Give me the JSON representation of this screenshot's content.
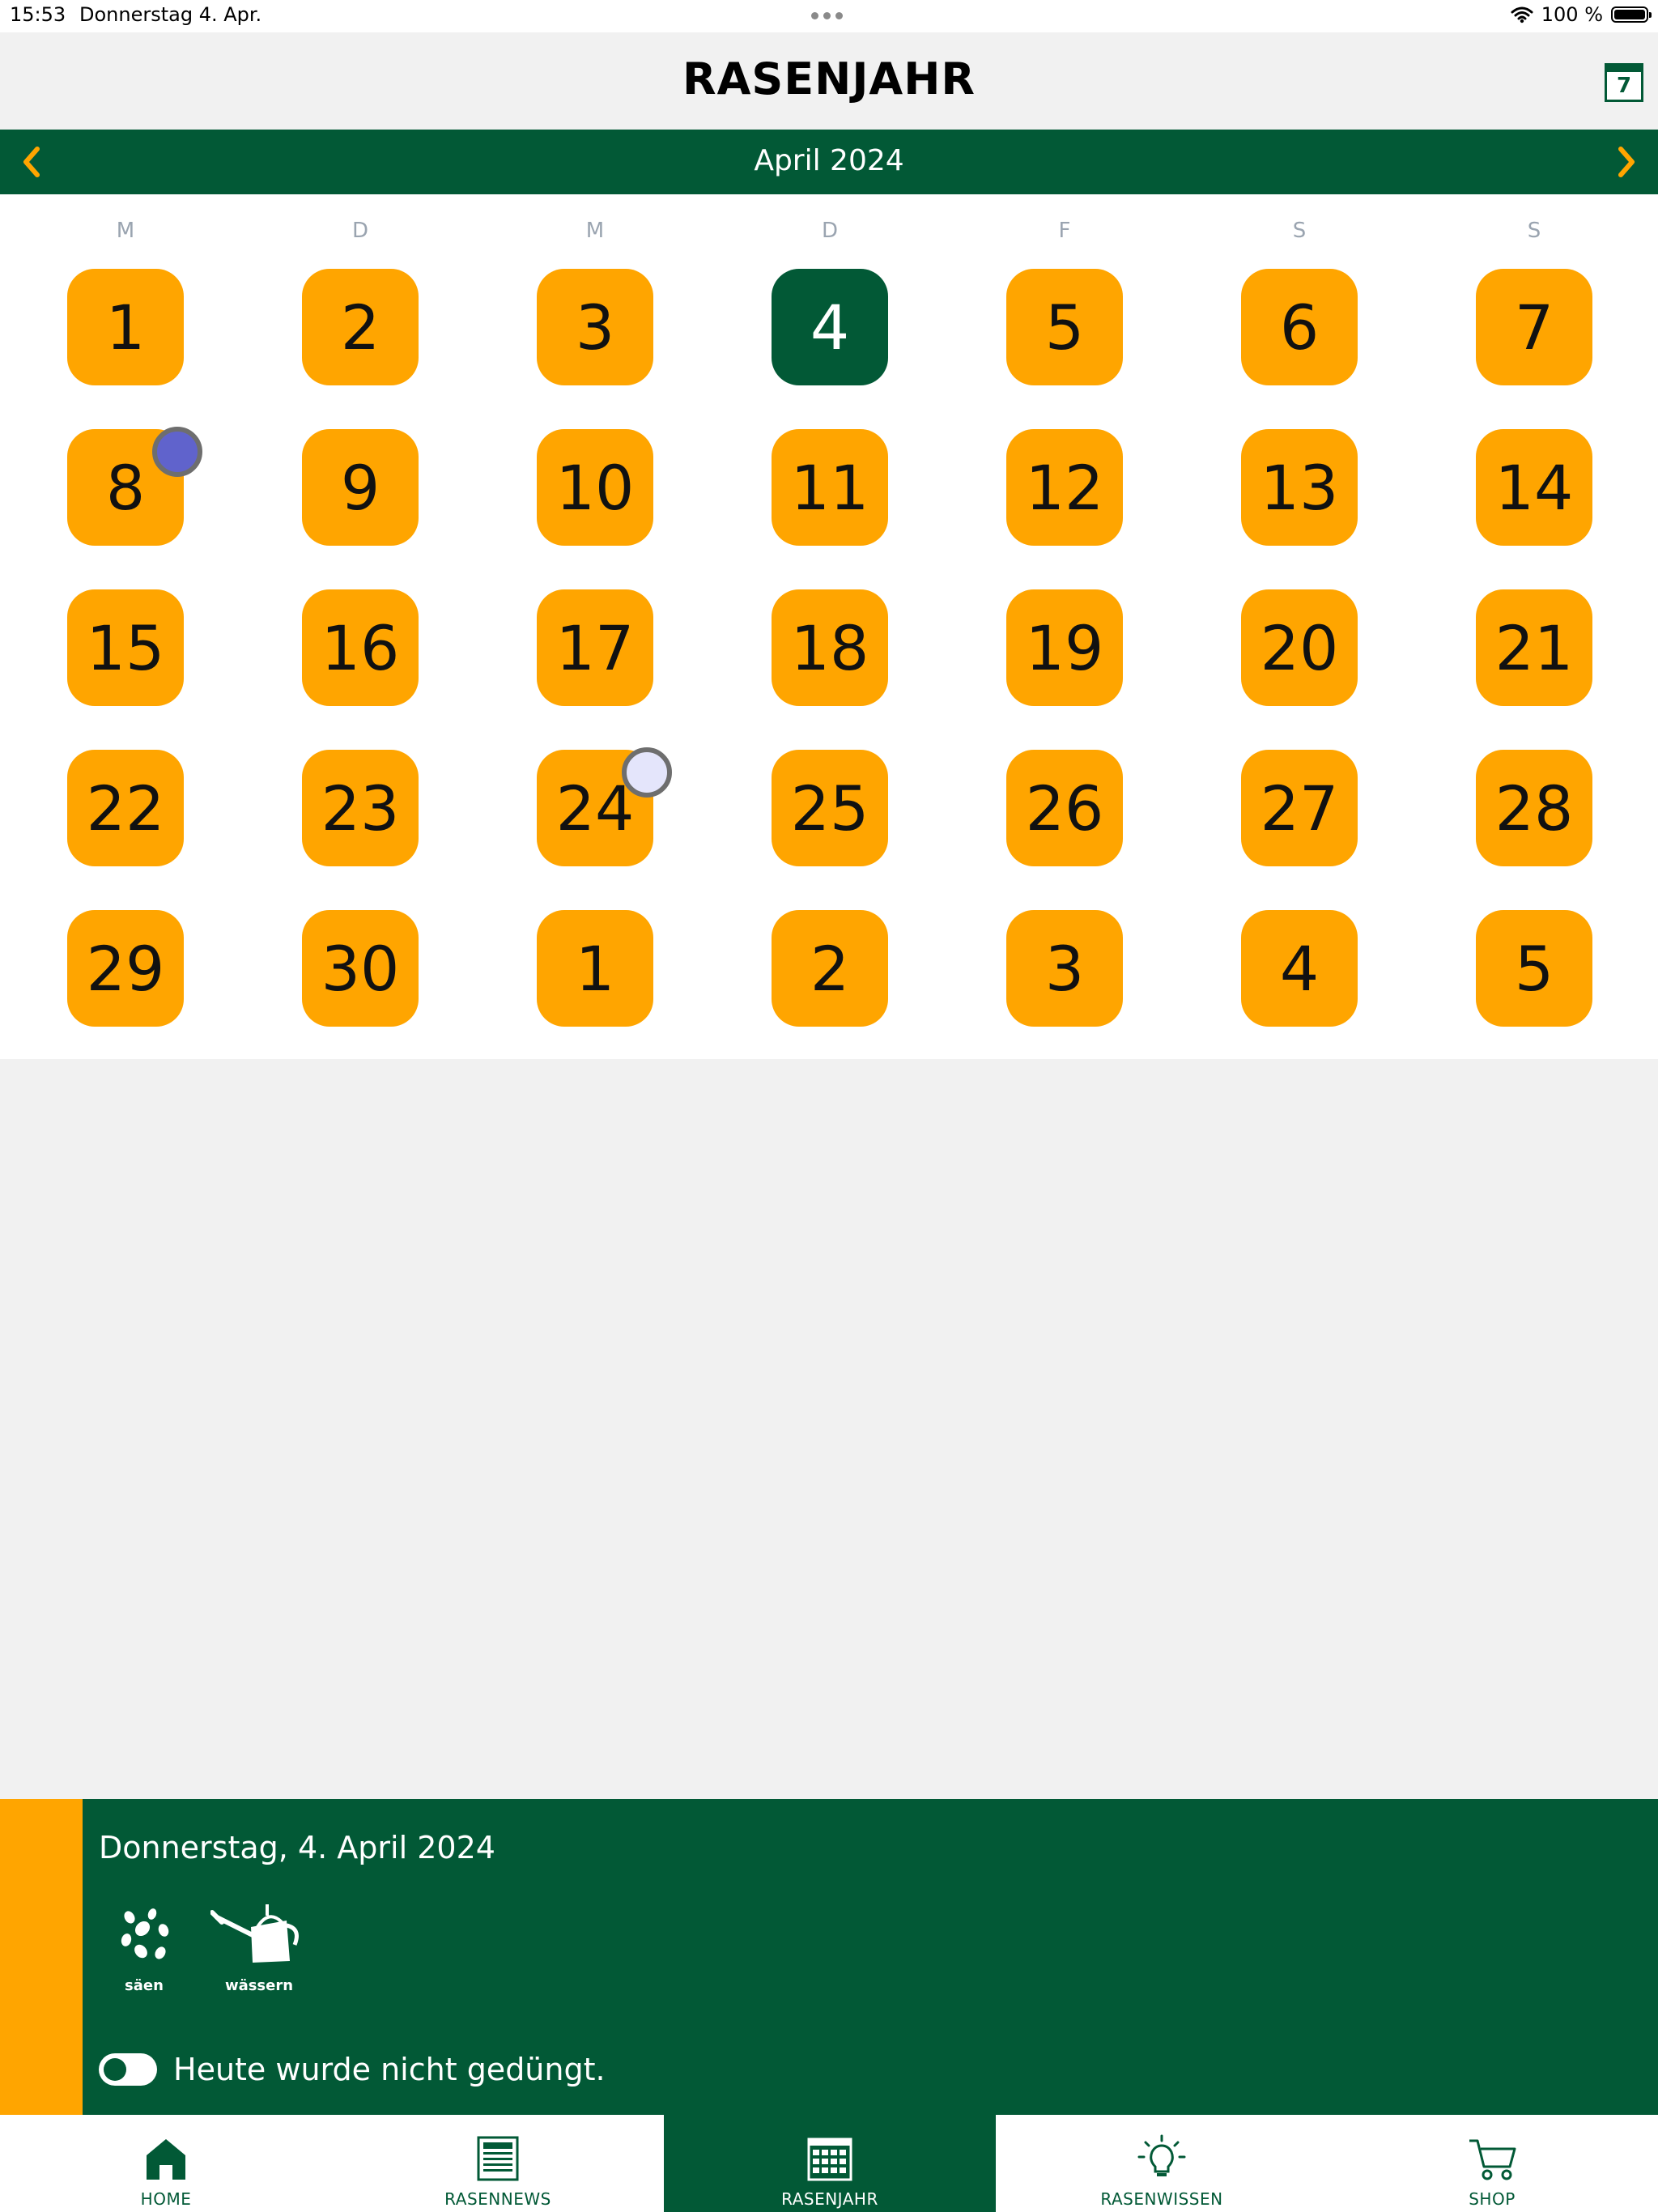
{
  "status_bar": {
    "time": "15:53",
    "date": "Donnerstag 4. Apr.",
    "battery": "100 %"
  },
  "header": {
    "title": "RASENJAHR",
    "calendar_button_day": "7"
  },
  "month_nav": {
    "label": "April 2024"
  },
  "calendar": {
    "weekdays": [
      "M",
      "D",
      "M",
      "D",
      "F",
      "S",
      "S"
    ],
    "weeks": [
      [
        "1",
        "2",
        "3",
        "4",
        "5",
        "6",
        "7"
      ],
      [
        "8",
        "9",
        "10",
        "11",
        "12",
        "13",
        "14"
      ],
      [
        "15",
        "16",
        "17",
        "18",
        "19",
        "20",
        "21"
      ],
      [
        "22",
        "23",
        "24",
        "25",
        "26",
        "27",
        "28"
      ],
      [
        "29",
        "30",
        "1",
        "2",
        "3",
        "4",
        "5"
      ]
    ],
    "selected_day": "4",
    "markers": [
      {
        "day": "8",
        "color": "#6063cc"
      },
      {
        "day": "24",
        "color": "#e4e5fb"
      }
    ]
  },
  "detail": {
    "date": "Donnerstag, 4. April 2024",
    "tasks": [
      {
        "label": "säen",
        "icon": "seeds-icon"
      },
      {
        "label": "wässern",
        "icon": "watering-can-icon"
      }
    ],
    "fertilized_text": "Heute wurde nicht gedüngt."
  },
  "tabs": [
    {
      "label": "HOME",
      "icon": "home-icon"
    },
    {
      "label": "RASENNEWS",
      "icon": "newspaper-icon"
    },
    {
      "label": "RASENJAHR",
      "icon": "calendar-grid-icon",
      "active": true
    },
    {
      "label": "RASENWISSEN",
      "icon": "lightbulb-icon"
    },
    {
      "label": "SHOP",
      "icon": "cart-icon"
    }
  ],
  "colors": {
    "primary": "#025936",
    "accent": "#ffa500",
    "background": "#f1f1f1"
  }
}
